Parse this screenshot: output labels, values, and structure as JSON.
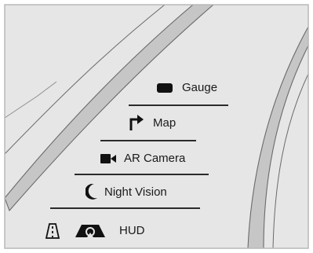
{
  "menu": {
    "items": [
      {
        "label": "Gauge",
        "icon": "gauge-icon"
      },
      {
        "label": "Map",
        "icon": "turn-arrow-icon"
      },
      {
        "label": "AR Camera",
        "icon": "video-camera-icon"
      },
      {
        "label": "Night Vision",
        "icon": "crescent-moon-icon"
      }
    ]
  },
  "hud": {
    "label": "HUD",
    "icons": [
      "lane-road-icon",
      "hud-projection-icon"
    ]
  },
  "colors": {
    "background": "#e6e6e6",
    "road_band": "#c6c6c6",
    "road_stroke": "#6a6a6a",
    "frame": "#b9b9b9",
    "text": "#1a1a1a"
  }
}
